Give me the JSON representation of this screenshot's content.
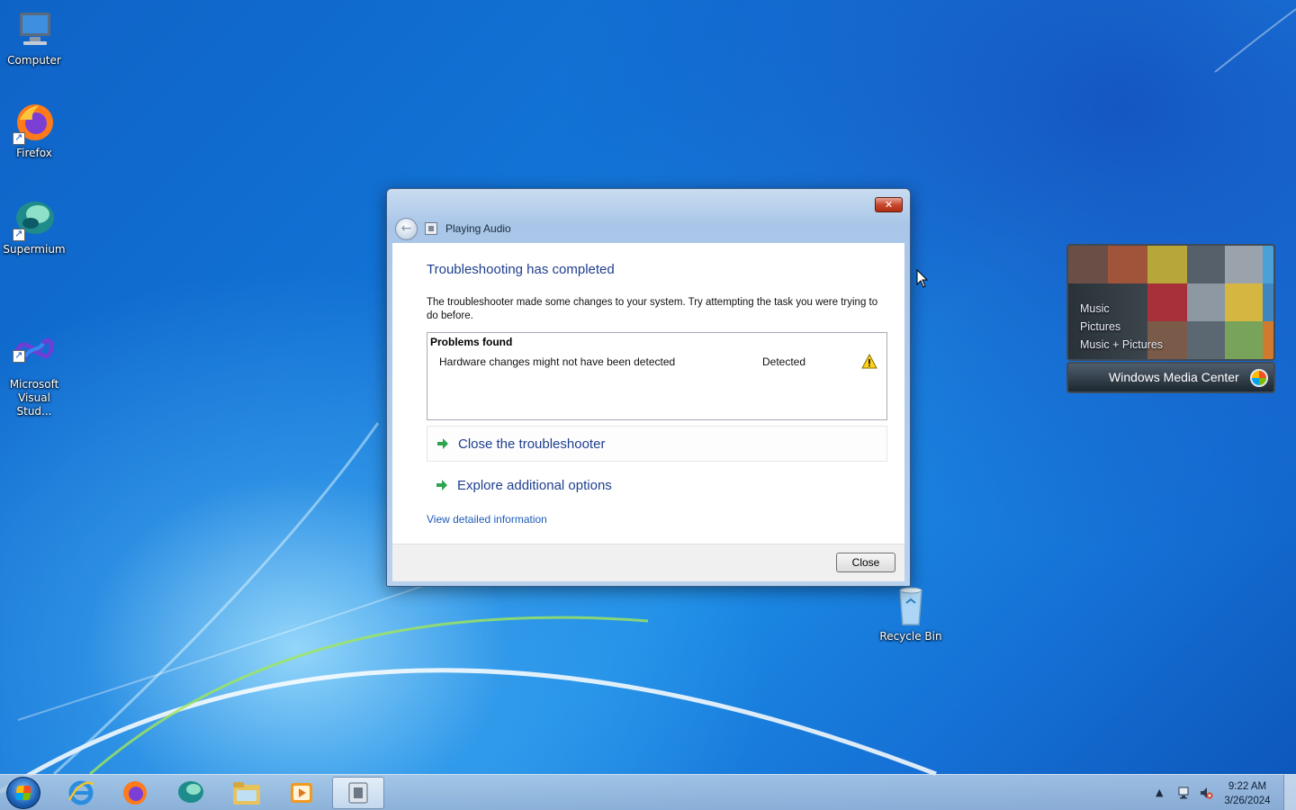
{
  "desktop": {
    "icons": [
      {
        "label": "Computer"
      },
      {
        "label": "Firefox"
      },
      {
        "label": "Supermium"
      },
      {
        "label": "Microsoft\nVisual Stud..."
      },
      {
        "label": "Recycle Bin"
      }
    ]
  },
  "window": {
    "title": "Playing Audio",
    "heading": "Troubleshooting has completed",
    "description": "The troubleshooter made some changes to your system. Try attempting the task you were trying to do before.",
    "problems": {
      "header": "Problems found",
      "rows": [
        {
          "name": "Hardware changes might not have been detected",
          "status": "Detected",
          "icon": "warning-icon"
        }
      ]
    },
    "options": [
      {
        "label": "Close the troubleshooter"
      },
      {
        "label": "Explore additional options"
      }
    ],
    "details_link": "View detailed information",
    "close_button": "Close"
  },
  "gadget": {
    "menu": [
      "Music",
      "Pictures",
      "Music + Pictures"
    ],
    "title": "Windows Media Center"
  },
  "taskbar": {
    "items": [
      "start-button",
      "internet-explorer-icon",
      "firefox-icon",
      "supermium-icon",
      "file-explorer-icon",
      "media-player-icon",
      "troubleshooter-icon"
    ],
    "clock": {
      "time": "9:22 AM",
      "date": "3/26/2024"
    }
  }
}
